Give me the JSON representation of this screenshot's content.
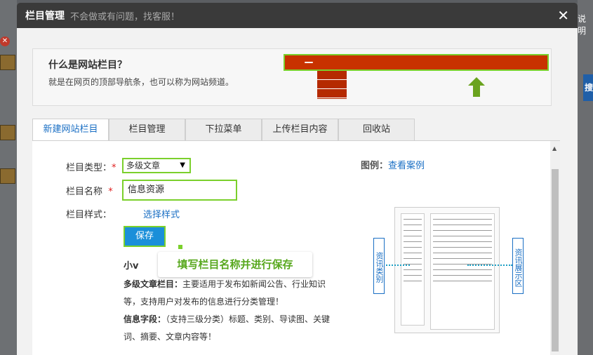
{
  "modal": {
    "title": "栏目管理",
    "subtitle": "不会做或有问题，找客服！",
    "close_glyph": "✕"
  },
  "info": {
    "title": "什么是网站栏目？",
    "description": "就是在网页的顶部导航条，也可以称为网站频道。"
  },
  "tabs": [
    {
      "label": "新建网站栏目",
      "active": true
    },
    {
      "label": "栏目管理",
      "active": false
    },
    {
      "label": "下拉菜单",
      "active": false
    },
    {
      "label": "上传栏目内容",
      "active": false
    },
    {
      "label": "回收站",
      "active": false
    }
  ],
  "form": {
    "type_label": "栏目类型：",
    "type_required": "*",
    "type_value": "多级文章",
    "name_label": "栏目名称",
    "name_required": "*",
    "name_value": "信息资源",
    "style_label": "栏目样式：",
    "style_link": "选择样式",
    "save_label": "保存"
  },
  "tooltip": "填写栏目名称并进行保存",
  "description": {
    "heading": "小v",
    "line1_bold": "多级文章栏目：",
    "line1": "主要适用于发布如新闻公告、行业知识等，支持用户对发布的信息进行分类管理！",
    "line2_bold": "信息字段：",
    "line2": "（支持三级分类）标题、类别、导读图、关键词、摘要、文章内容等！"
  },
  "example": {
    "label": "图例：",
    "link": "查看案例"
  },
  "diagram": {
    "left_label": "资讯类别",
    "right_label": "资讯展示区"
  },
  "background": {
    "right_text": "说明",
    "right_button": "搜"
  },
  "colors": {
    "accent_green": "#7bd02c",
    "link_blue": "#1a6fc4",
    "save_blue": "#1a8fd9",
    "nav_red": "#c83200"
  }
}
